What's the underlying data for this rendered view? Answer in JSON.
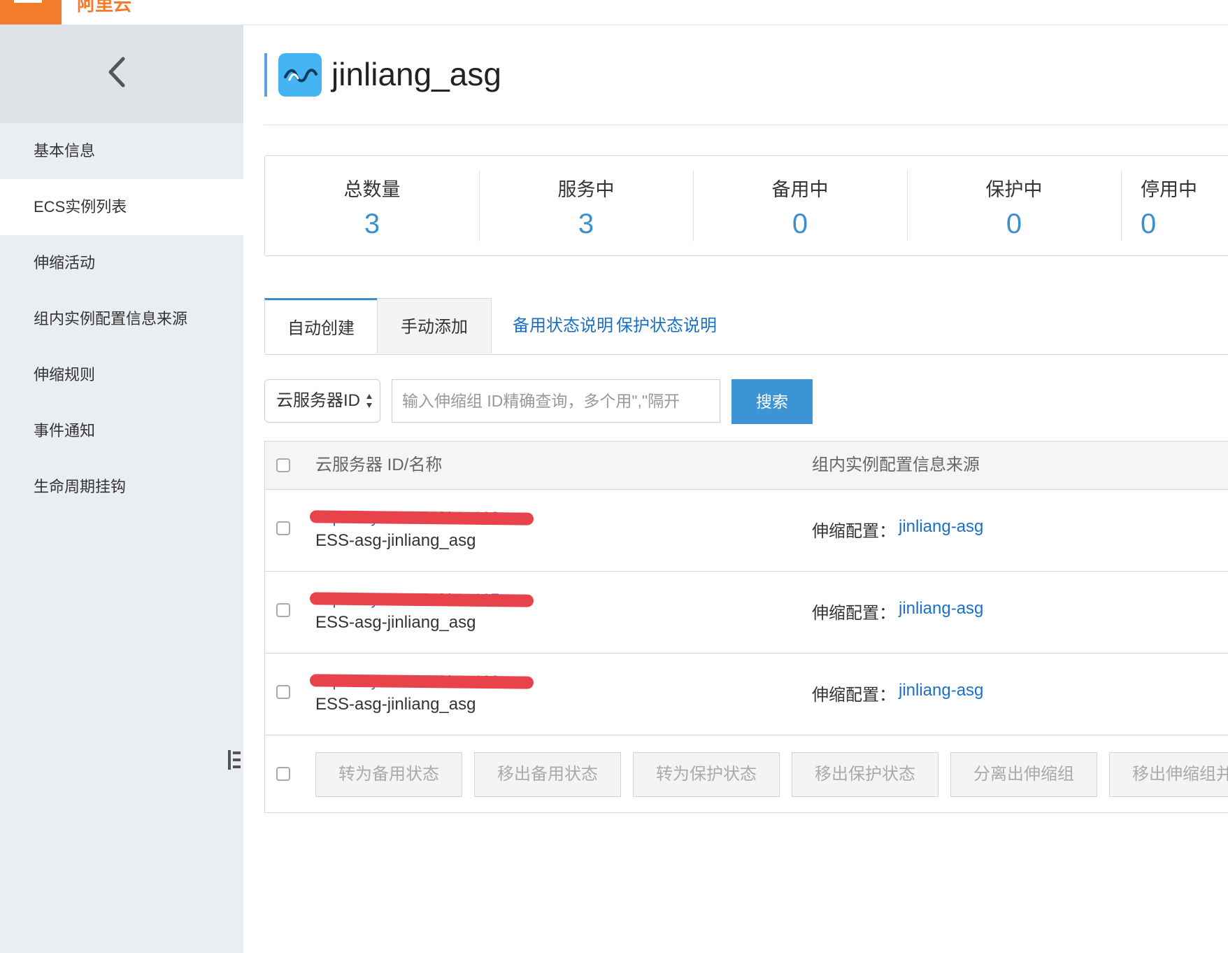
{
  "brand": {
    "logo_text": "阿里云",
    "accent": "#f27c2b"
  },
  "sidebar": {
    "items": [
      {
        "label": "基本信息"
      },
      {
        "label": "ECS实例列表",
        "active": true
      },
      {
        "label": "伸缩活动"
      },
      {
        "label": "组内实例配置信息来源"
      },
      {
        "label": "伸缩规则"
      },
      {
        "label": "事件通知"
      },
      {
        "label": "生命周期挂钩"
      }
    ]
  },
  "header": {
    "title": "jinliang_asg"
  },
  "stats": [
    {
      "label": "总数量",
      "value": "3"
    },
    {
      "label": "服务中",
      "value": "3"
    },
    {
      "label": "备用中",
      "value": "0"
    },
    {
      "label": "保护中",
      "value": "0"
    },
    {
      "label": "停用中",
      "value": "0"
    }
  ],
  "tabs": {
    "auto": "自动创建",
    "manual": "手动添加",
    "standby_help": "备用状态说明",
    "protect_help": "保护状态说明"
  },
  "search": {
    "select_value": "云服务器ID",
    "placeholder": "输入伸缩组 ID精确查询，多个用\",\"隔开",
    "button": "搜索"
  },
  "table": {
    "columns": {
      "id_name": "云服务器 ID/名称",
      "config_source": "组内实例配置信息来源"
    },
    "rows": [
      {
        "instance_id": "i-bp1emy14ktx2k4kb3e198",
        "name": "ESS-asg-jinliang_asg",
        "config_label": "伸缩配置：",
        "config_value": "jinliang-asg"
      },
      {
        "instance_id": "i-bp1emy14ktx2k4kb3e197",
        "name": "ESS-asg-jinliang_asg",
        "config_label": "伸缩配置：",
        "config_value": "jinliang-asg"
      },
      {
        "instance_id": "i-bp1emy14ktx2k4kb3e196",
        "name": "ESS-asg-jinliang_asg",
        "config_label": "伸缩配置：",
        "config_value": "jinliang-asg"
      }
    ],
    "actions": [
      "转为备用状态",
      "移出备用状态",
      "转为保护状态",
      "移出保护状态",
      "分离出伸缩组",
      "移出伸缩组并释放"
    ]
  }
}
